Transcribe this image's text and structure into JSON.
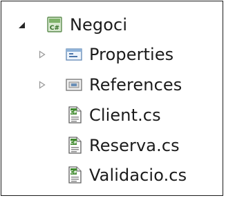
{
  "tree": {
    "project": {
      "label": "Negoci",
      "icon": "csharp-project-icon",
      "expanded": true
    },
    "items": [
      {
        "label": "Properties",
        "icon": "properties-folder-icon",
        "expandable": true,
        "expanded": false
      },
      {
        "label": "References",
        "icon": "references-folder-icon",
        "expandable": true,
        "expanded": false
      },
      {
        "label": "Client.cs",
        "icon": "csharp-file-icon",
        "expandable": false
      },
      {
        "label": "Reserva.cs",
        "icon": "csharp-file-icon",
        "expandable": false
      },
      {
        "label": "Validacio.cs",
        "icon": "csharp-file-icon",
        "expandable": false
      }
    ]
  }
}
